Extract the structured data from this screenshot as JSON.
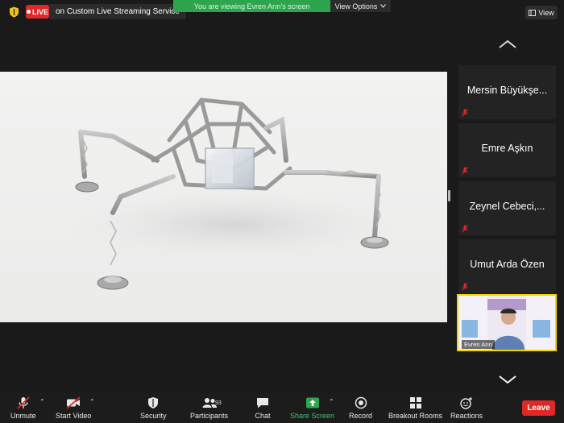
{
  "topbar": {
    "live_label": "LIVE",
    "stream_label": "on Custom Live Streaming Service",
    "viewing_banner": "You are viewing Evren Arın's screen",
    "view_options_label": "View Options",
    "view_button_label": "View"
  },
  "participants_panel": {
    "tiles": [
      {
        "name": "Mersin Büyükşe..."
      },
      {
        "name": "Emre Aşkın"
      },
      {
        "name": "Zeynel Cebeci,..."
      },
      {
        "name": "Umut Arda Özen"
      }
    ],
    "active_video": {
      "name": "Evren Arın"
    }
  },
  "toolbar": {
    "unmute": "Unmute",
    "start_video": "Start Video",
    "security": "Security",
    "participants": "Participants",
    "participants_count": "93",
    "chat": "Chat",
    "share_screen": "Share Screen",
    "record": "Record",
    "breakout_rooms": "Breakout Rooms",
    "reactions": "Reactions",
    "leave": "Leave"
  },
  "colors": {
    "live_red": "#e02828",
    "banner_green": "#2ea44f",
    "share_green": "#2ea44f",
    "active_speaker": "#f1d400"
  }
}
